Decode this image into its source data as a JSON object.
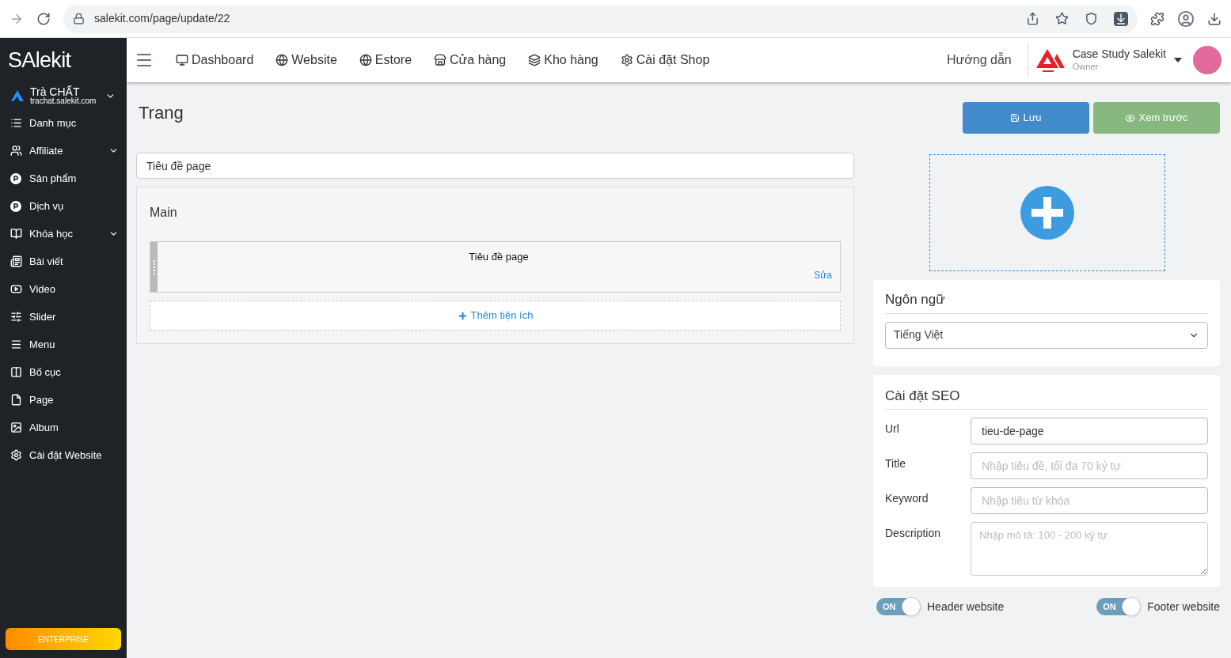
{
  "browser": {
    "url": "salekit.com/page/update/22"
  },
  "sidebar": {
    "logo": "SAlekit",
    "shop": {
      "name": "Trà CHẤT",
      "domain": "trachat.salekit.com"
    },
    "items": [
      {
        "label": "Danh mục",
        "has_submenu": false
      },
      {
        "label": "Affiliate",
        "has_submenu": true
      },
      {
        "label": "Sản phẩm",
        "has_submenu": false
      },
      {
        "label": "Dịch vụ",
        "has_submenu": false
      },
      {
        "label": "Khóa học",
        "has_submenu": true
      },
      {
        "label": "Bài viết",
        "has_submenu": false
      },
      {
        "label": "Video",
        "has_submenu": false
      },
      {
        "label": "Slider",
        "has_submenu": false
      },
      {
        "label": "Menu",
        "has_submenu": false
      },
      {
        "label": "Bố cục",
        "has_submenu": false
      },
      {
        "label": "Page",
        "has_submenu": false
      },
      {
        "label": "Album",
        "has_submenu": false
      },
      {
        "label": "Cài đặt Website",
        "has_submenu": false
      }
    ],
    "plan": "ENTERPRISE"
  },
  "topnav": {
    "items": [
      {
        "label": "Dashboard"
      },
      {
        "label": "Website"
      },
      {
        "label": "Estore"
      },
      {
        "label": "Cửa hàng"
      },
      {
        "label": "Kho hàng"
      },
      {
        "label": "Cài đặt Shop"
      }
    ],
    "help": "Hướng dẫn",
    "account": {
      "name": "Case Study Salekit",
      "role": "Owner"
    }
  },
  "page": {
    "title": "Trang",
    "title_field": {
      "value": "Tiêu đề page"
    },
    "section": {
      "title": "Main",
      "widgets": [
        {
          "title": "Tiêu đề page",
          "edit": "Sửa"
        }
      ],
      "add": "Thêm tiện ích"
    }
  },
  "actions": {
    "save": "Lưu",
    "preview": "Xem trước"
  },
  "language": {
    "title": "Ngôn ngữ",
    "value": "Tiếng Việt"
  },
  "seo": {
    "title": "Cài đặt SEO",
    "fields": [
      {
        "label": "Url",
        "value": "tieu-de-page",
        "kind": "input"
      },
      {
        "label": "Title",
        "placeholder": "Nhập tiêu đề, tối đa 70 ký tự",
        "kind": "input"
      },
      {
        "label": "Keyword",
        "placeholder": "Nhập tiêu từ khóa",
        "kind": "input"
      },
      {
        "label": "Description",
        "placeholder": "Nhập mô tả: 100 - 200 ký tự",
        "kind": "textarea"
      }
    ]
  },
  "toggles": [
    {
      "label": "Header website",
      "on": true,
      "text": "ON"
    },
    {
      "label": "Footer website",
      "on": true,
      "text": "ON"
    }
  ]
}
